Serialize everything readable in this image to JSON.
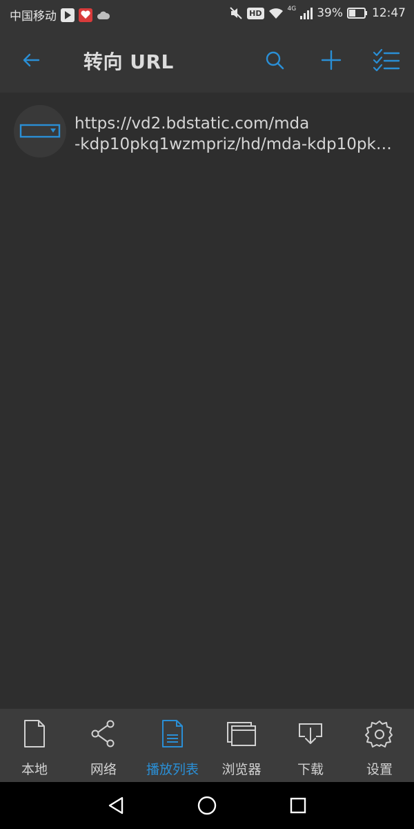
{
  "status_bar": {
    "carrier": "中国移动",
    "hd_badge": "HD",
    "network": "4G",
    "battery": "39%",
    "time": "12:47"
  },
  "app_bar": {
    "title": "转向 URL"
  },
  "list": [
    {
      "url_line1": "https://vd2.bdstatic.com/mda",
      "url_line2": "-kdp10pkq1wzmpriz/hd/mda-kdp10pk…"
    }
  ],
  "bottom_nav": [
    {
      "label": "本地",
      "icon": "file-icon",
      "active": false
    },
    {
      "label": "网络",
      "icon": "share-icon",
      "active": false
    },
    {
      "label": "播放列表",
      "icon": "playlist-icon",
      "active": true
    },
    {
      "label": "浏览器",
      "icon": "browser-icon",
      "active": false
    },
    {
      "label": "下载",
      "icon": "download-icon",
      "active": false
    },
    {
      "label": "设置",
      "icon": "settings-icon",
      "active": false
    }
  ],
  "colors": {
    "accent": "#2a8fd6",
    "background": "#2e2e2e",
    "bar": "#353535",
    "nav": "#3c3c3c"
  }
}
